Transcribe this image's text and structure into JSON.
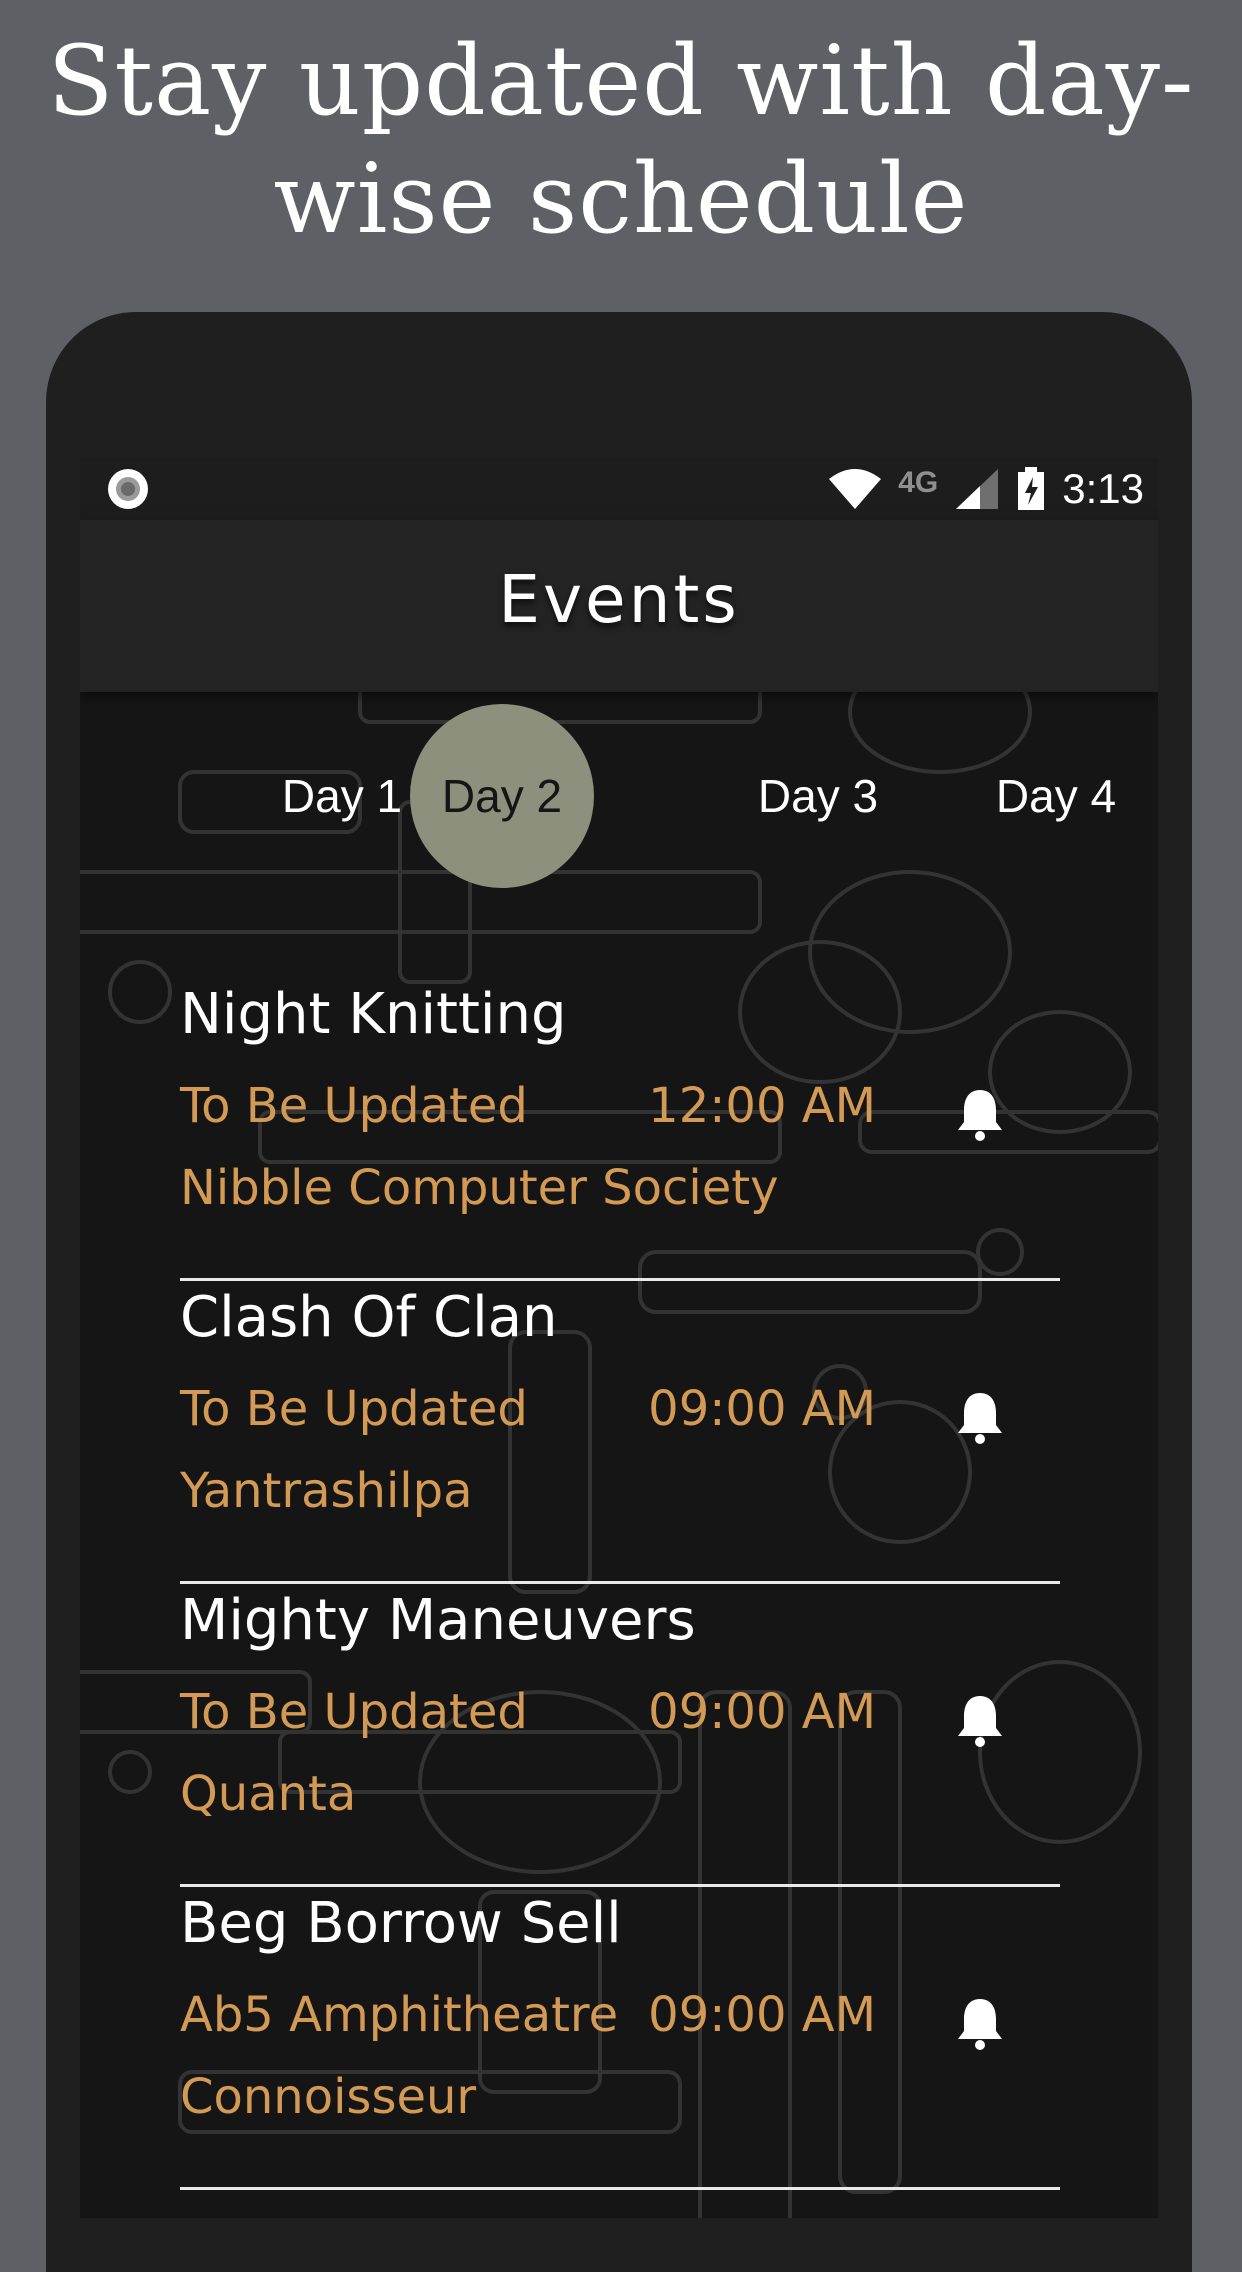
{
  "promo": {
    "title": "Stay updated with day-wise schedule"
  },
  "statusbar": {
    "network": "4G",
    "time": "3:13"
  },
  "appbar": {
    "title": "Events"
  },
  "tabs": [
    {
      "label": "Day 1",
      "active": false
    },
    {
      "label": "Day 2",
      "active": true
    },
    {
      "label": "Day 3",
      "active": false
    },
    {
      "label": "Day 4",
      "active": false
    }
  ],
  "events": [
    {
      "name": "Night Knitting",
      "venue": "To Be Updated",
      "time": "12:00 AM",
      "club": "Nibble Computer Society"
    },
    {
      "name": "Clash Of Clan",
      "venue": "To Be Updated",
      "time": "09:00 AM",
      "club": "Yantrashilpa"
    },
    {
      "name": "Mighty Maneuvers",
      "venue": "To Be Updated",
      "time": "09:00 AM",
      "club": "Quanta"
    },
    {
      "name": "Beg Borrow Sell",
      "venue": "Ab5 Amphitheatre",
      "time": "09:00 AM",
      "club": "Connoisseur"
    }
  ],
  "colors": {
    "background": "#5f6065",
    "accent": "#d39a55",
    "active_tab": "#8c907c",
    "text": "#ffffff"
  },
  "icons": {
    "event_reminder": "bell-icon",
    "status_wifi": "wifi-icon",
    "status_signal": "signal-icon",
    "status_battery": "battery-charging-icon",
    "status_record": "record-icon"
  }
}
